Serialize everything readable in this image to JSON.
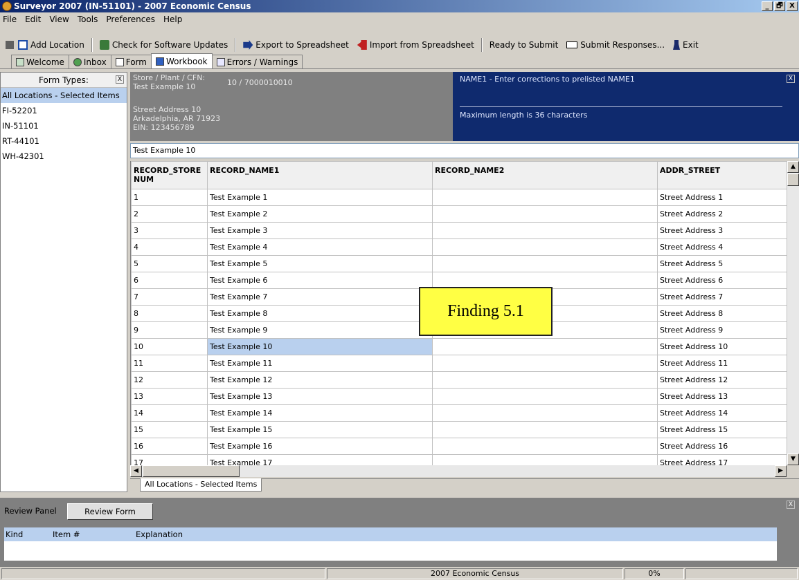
{
  "window": {
    "title": "Surveyor 2007 (IN-51101) - 2007 Economic Census",
    "min": "_",
    "max": "🗗",
    "close": "X"
  },
  "menu": [
    "File",
    "Edit",
    "View",
    "Tools",
    "Preferences",
    "Help"
  ],
  "toolbar": {
    "add_location": "Add Location",
    "check_updates": "Check for Software Updates",
    "export": "Export to Spreadsheet",
    "import": "Import from Spreadsheet",
    "ready": "Ready to Submit",
    "submit": "Submit Responses...",
    "exit": "Exit"
  },
  "tabs": [
    "Welcome",
    "Inbox",
    "Form",
    "Workbook",
    "Errors / Warnings"
  ],
  "left_panel": {
    "header": "Form Types:",
    "items": [
      "All Locations - Selected Items",
      "FI-52201",
      "IN-51101",
      "RT-44101",
      "WH-42301"
    ]
  },
  "info": {
    "label1": "Store / Plant / CFN:",
    "cfn": "10 / 7000010010",
    "name": "Test Example 10",
    "street": "Street Address 10",
    "city": "Arkadelphia, AR 71923",
    "ein": "EIN: 123456789"
  },
  "help": {
    "title": "NAME1 - Enter corrections to prelisted NAME1",
    "max": "Maximum length is 36 characters"
  },
  "edit_value": "Test Example 10",
  "grid": {
    "columns": [
      "RECORD_STORE NUM",
      "RECORD_NAME1",
      "RECORD_NAME2",
      "ADDR_STREET"
    ],
    "rows": [
      [
        "1",
        "Test Example 1",
        "",
        "Street Address 1"
      ],
      [
        "2",
        "Test Example 2",
        "",
        "Street Address 2"
      ],
      [
        "3",
        "Test Example 3",
        "",
        "Street Address 3"
      ],
      [
        "4",
        "Test Example 4",
        "",
        "Street Address 4"
      ],
      [
        "5",
        "Test Example 5",
        "",
        "Street Address 5"
      ],
      [
        "6",
        "Test Example 6",
        "",
        "Street Address 6"
      ],
      [
        "7",
        "Test Example 7",
        "",
        "Street Address 7"
      ],
      [
        "8",
        "Test Example 8",
        "",
        "Street Address 8"
      ],
      [
        "9",
        "Test Example 9",
        "",
        "Street Address 9"
      ],
      [
        "10",
        "Test Example 10",
        "",
        "Street Address 10"
      ],
      [
        "11",
        "Test Example 11",
        "",
        "Street Address 11"
      ],
      [
        "12",
        "Test Example 12",
        "",
        "Street Address 12"
      ],
      [
        "13",
        "Test Example 13",
        "",
        "Street Address 13"
      ],
      [
        "14",
        "Test Example 14",
        "",
        "Street Address 14"
      ],
      [
        "15",
        "Test Example 15",
        "",
        "Street Address 15"
      ],
      [
        "16",
        "Test Example 16",
        "",
        "Street Address 16"
      ],
      [
        "17",
        "Test Example 17",
        "",
        "Street Address 17"
      ]
    ],
    "selected_row": 9
  },
  "sheet_tab": "All Locations - Selected Items",
  "callout": "Finding 5.1",
  "review": {
    "title": "Review Panel",
    "button": "Review Form",
    "cols": [
      "Kind",
      "Item #",
      "Explanation"
    ]
  },
  "status": {
    "center": "2007 Economic Census",
    "progress": "0%"
  }
}
